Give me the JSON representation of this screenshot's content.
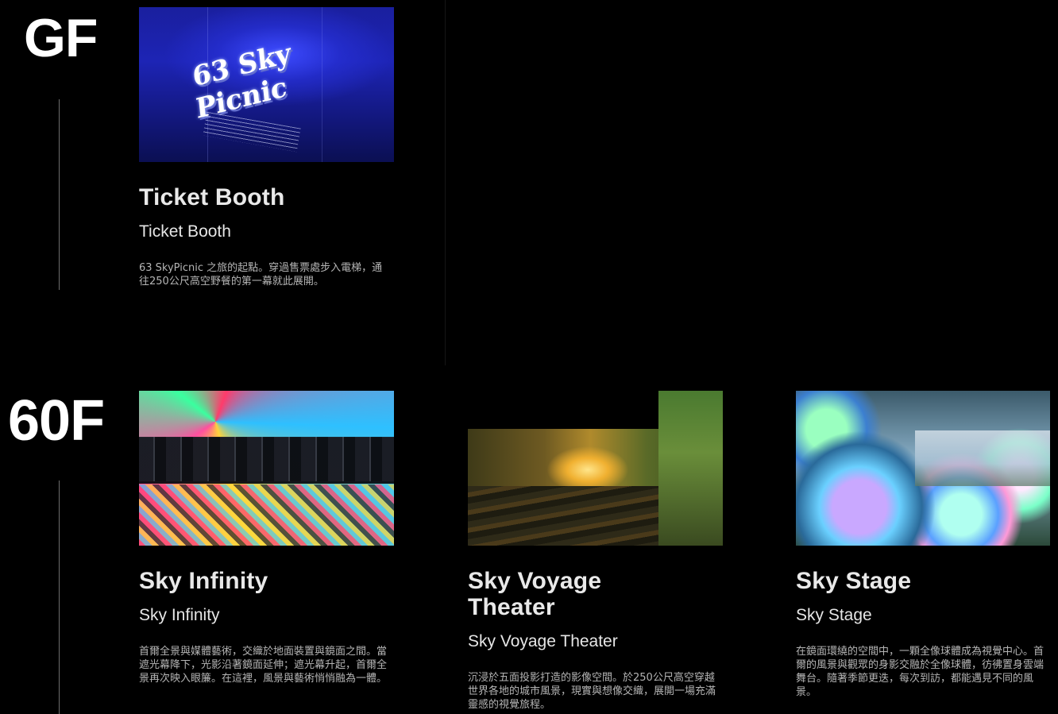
{
  "floors": [
    {
      "label": "GF",
      "cards": [
        {
          "image_sign": "63 Sky Picnic",
          "title": "Ticket Booth",
          "subtitle": "Ticket Booth",
          "description": "63 SkyPicnic 之旅的起點。穿過售票處步入電梯，通往250公尺高空野餐的第一幕就此展開。"
        }
      ]
    },
    {
      "label": "60F",
      "cards": [
        {
          "title": "Sky Infinity",
          "subtitle": "Sky Infinity",
          "description": "首爾全景與媒體藝術，交織於地面裝置與鏡面之間。當遮光幕降下，光影沿著鏡面延伸；遮光幕升起，首爾全景再次映入眼簾。在這裡，風景與藝術悄悄融為一體。"
        },
        {
          "title": "Sky Voyage Theater",
          "subtitle": "Sky Voyage Theater",
          "description": "沉浸於五面投影打造的影像空間。於250公尺高空穿越世界各地的城市風景，現實與想像交織，展開一場充滿靈感的視覺旅程。"
        },
        {
          "title": "Sky Stage",
          "subtitle": "Sky Stage",
          "description": "在鏡面環繞的空間中，一顆全像球體成為視覺中心。首爾的風景與觀眾的身影交融於全像球體，彷彿置身雲端舞台。隨著季節更迭，每次到訪，都能遇見不同的風景。"
        }
      ]
    }
  ]
}
